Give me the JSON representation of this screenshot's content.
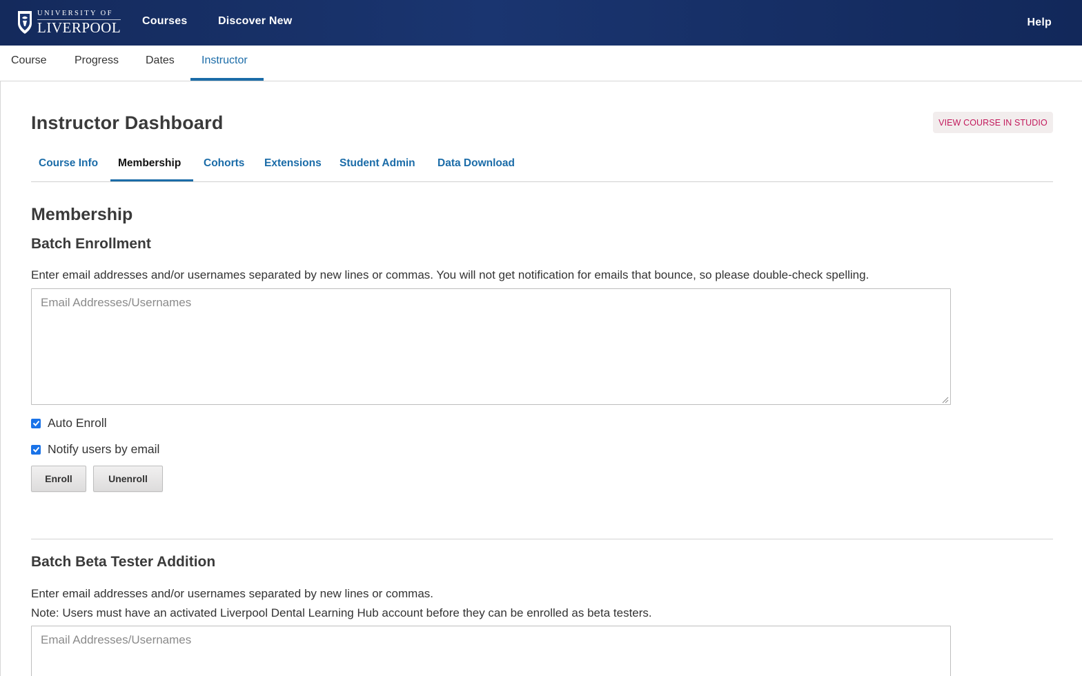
{
  "header": {
    "logo_small": "UNIVERSITY OF",
    "logo_big": "LIVERPOOL",
    "nav": [
      "Courses",
      "Discover New"
    ],
    "help": "Help"
  },
  "course_tabs": [
    "Course",
    "Progress",
    "Dates",
    "Instructor"
  ],
  "dashboard": {
    "title": "Instructor Dashboard",
    "studio_button": "VIEW COURSE IN STUDIO",
    "tabs": [
      "Course Info",
      "Membership",
      "Cohorts",
      "Extensions",
      "Student Admin",
      "Data Download"
    ]
  },
  "membership": {
    "heading": "Membership",
    "batch_enrollment": {
      "heading": "Batch Enrollment",
      "description": "Enter email addresses and/or usernames separated by new lines or commas. You will not get notification for emails that bounce, so please double-check spelling.",
      "placeholder": "Email Addresses/Usernames",
      "auto_enroll": "Auto Enroll",
      "notify_users": "Notify users by email",
      "enroll_button": "Enroll",
      "unenroll_button": "Unenroll"
    },
    "beta_testers": {
      "heading": "Batch Beta Tester Addition",
      "description_line1": "Enter email addresses and/or usernames separated by new lines or commas.",
      "description_line2": "Note: Users must have an activated Liverpool Dental Learning Hub account before they can be enrolled as beta testers.",
      "placeholder": "Email Addresses/Usernames"
    }
  },
  "colors": {
    "header_bg": "#142a5c",
    "link_blue": "#1b6ca8",
    "studio_text": "#c2185b",
    "checkbox": "#1a73e8"
  }
}
